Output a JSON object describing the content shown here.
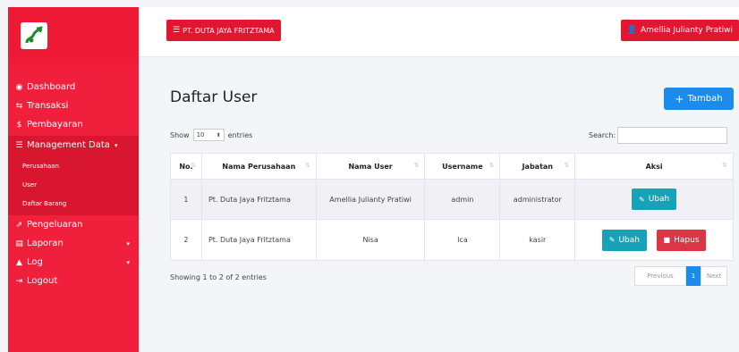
{
  "sidebar": {
    "items": [
      {
        "icon": "dashboard-icon",
        "glyph": "◉",
        "label": "Dashboard"
      },
      {
        "icon": "transaction-icon",
        "glyph": "⇆",
        "label": "Transaksi"
      },
      {
        "icon": "dollar-icon",
        "glyph": "$",
        "label": "Pembayaran"
      },
      {
        "icon": "menu-list-icon",
        "glyph": "☰",
        "label": "Management Data"
      },
      {
        "icon": "external-link-icon",
        "glyph": "⇗",
        "label": "Pengeluaran"
      },
      {
        "icon": "report-icon",
        "glyph": "▤",
        "label": "Laporan"
      },
      {
        "icon": "log-icon",
        "glyph": "▲",
        "label": "Log"
      },
      {
        "icon": "logout-icon",
        "glyph": "⇥",
        "label": "Logout"
      }
    ],
    "submenu": [
      "Perusahaan",
      "User",
      "Daftar Barang"
    ],
    "caret": "▾"
  },
  "topbar": {
    "company_glyph": "☰",
    "company": "PT. DUTA JAYA FRITZTAMA",
    "user_glyph": "👤",
    "user": "Amellia Julianty Pratiwi"
  },
  "main": {
    "title": "Daftar User",
    "add_glyph": "+",
    "add_label": "Tambah",
    "show_label": "Show",
    "entries_value": "10",
    "entries_label": "entries",
    "search_label": "Search:",
    "columns": [
      "No.",
      "Nama Perusahaan",
      "Nama User",
      "Username",
      "Jabatan",
      "Aksi"
    ],
    "sort_glyph": "⇅",
    "rows": [
      {
        "no": "1",
        "perusahaan": "Pt. Duta Jaya Fritztama",
        "nama": "Amellia Julianty Pratiwi",
        "username": "admin",
        "jabatan": "administrator",
        "actions": [
          "Ubah"
        ]
      },
      {
        "no": "2",
        "perusahaan": "Pt. Duta Jaya Fritztama",
        "nama": "Nisa",
        "username": "Ica",
        "jabatan": "kasir",
        "actions": [
          "Ubah",
          "Hapus"
        ]
      }
    ],
    "edit_glyph": "✎",
    "delete_glyph": "■",
    "showing": "Showing 1 to 2 of 2 entries",
    "pagination": {
      "prev": "Previous",
      "current": "1",
      "next": "Next"
    }
  },
  "colors": {
    "sidebar": "#f0203d",
    "primary": "#1a8cee",
    "info": "#17a2b8",
    "danger": "#dc3545"
  }
}
